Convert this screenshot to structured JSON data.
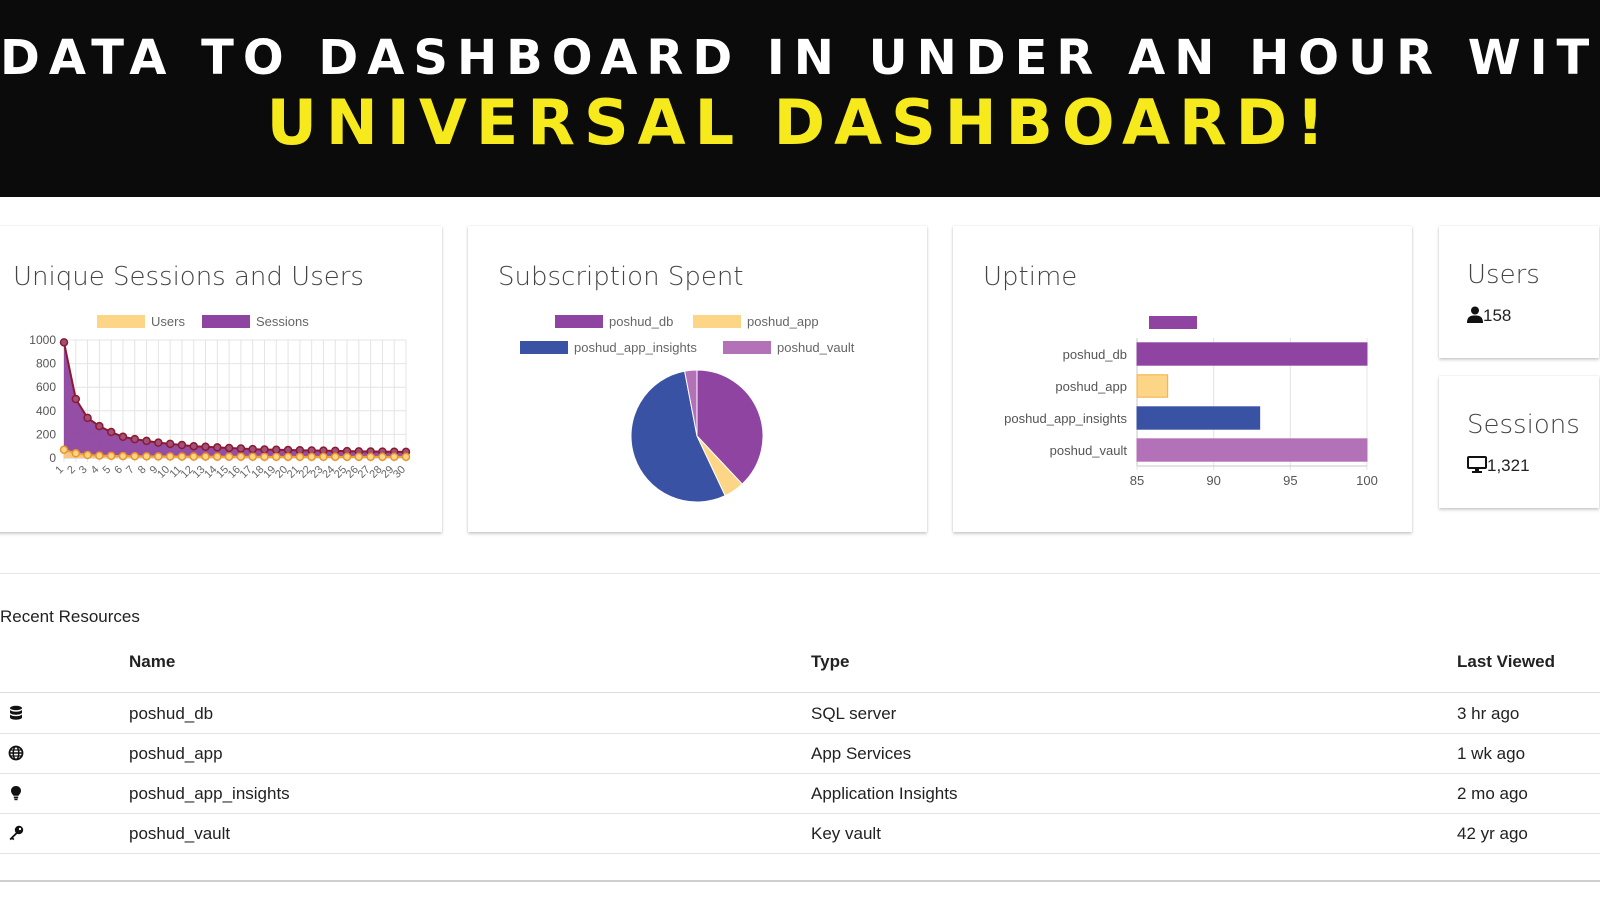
{
  "banner": {
    "line1": "Data to dashboard in under an hour with",
    "line2": "Universal Dashboard!"
  },
  "colors": {
    "banner_bg": "#0b0b0b",
    "banner_yellow": "#f7ea1c",
    "purple": "#8e44a0",
    "dark_red": "#8b1a2e",
    "yellow": "#fdd587",
    "blue": "#3a52a3",
    "lavender": "#b371b8"
  },
  "sessions_card": {
    "title": "Unique Sessions and Users",
    "legend": [
      "Users",
      "Sessions"
    ]
  },
  "subscription_card": {
    "title": "Subscription Spent",
    "legend": [
      "poshud_db",
      "poshud_app",
      "poshud_app_insights",
      "poshud_vault"
    ]
  },
  "uptime_card": {
    "title": "Uptime"
  },
  "users_card": {
    "title": "Users",
    "icon": "user-icon",
    "value": "158"
  },
  "sessions_stat_card": {
    "title": "Sessions",
    "icon": "monitor-icon",
    "value": "1,321"
  },
  "recent": {
    "title": "Recent Resources",
    "headers": [
      "Name",
      "Type",
      "Last Viewed"
    ],
    "rows": [
      {
        "icon": "database-icon",
        "name": "poshud_db",
        "type": "SQL server",
        "last": "3 hr ago"
      },
      {
        "icon": "globe-icon",
        "name": "poshud_app",
        "type": "App Services",
        "last": "1 wk ago"
      },
      {
        "icon": "lightbulb-icon",
        "name": "poshud_app_insights",
        "type": "Application Insights",
        "last": "2 mo ago"
      },
      {
        "icon": "key-icon",
        "name": "poshud_vault",
        "type": "Key vault",
        "last": "42 yr ago"
      }
    ]
  },
  "chart_data": [
    {
      "type": "area",
      "title": "Unique Sessions and Users",
      "x": [
        1,
        2,
        3,
        4,
        5,
        6,
        7,
        8,
        9,
        10,
        11,
        12,
        13,
        14,
        15,
        16,
        17,
        18,
        19,
        20,
        21,
        22,
        23,
        24,
        25,
        26,
        27,
        28,
        29,
        30
      ],
      "yticks": [
        "0",
        "200",
        "400",
        "600",
        "800",
        "1000"
      ],
      "ylim": [
        0,
        1000
      ],
      "grid": true,
      "legend_position": "top",
      "series": [
        {
          "name": "Users",
          "color": "#fdd587",
          "values": [
            70,
            40,
            25,
            20,
            18,
            16,
            15,
            14,
            13,
            13,
            12,
            12,
            12,
            11,
            11,
            11,
            11,
            10,
            10,
            10,
            10,
            10,
            10,
            10,
            10,
            10,
            10,
            10,
            10,
            10
          ]
        },
        {
          "name": "Sessions",
          "color": "#8e44a0",
          "values": [
            980,
            500,
            340,
            270,
            220,
            180,
            160,
            145,
            130,
            120,
            110,
            100,
            95,
            90,
            85,
            80,
            75,
            72,
            70,
            68,
            66,
            64,
            62,
            60,
            58,
            56,
            55,
            54,
            53,
            52
          ]
        }
      ]
    },
    {
      "type": "pie",
      "title": "Subscription Spent",
      "legend_position": "top",
      "categories": [
        "poshud_db",
        "poshud_app",
        "poshud_app_insights",
        "poshud_vault"
      ],
      "values": [
        38,
        5,
        54,
        3
      ],
      "colors": [
        "#8e44a0",
        "#fdd587",
        "#3a52a3",
        "#b371b8"
      ]
    },
    {
      "type": "bar",
      "orientation": "horizontal",
      "title": "Uptime",
      "categories": [
        "poshud_db",
        "poshud_app",
        "poshud_app_insights",
        "poshud_vault"
      ],
      "values": [
        100,
        87,
        93,
        100
      ],
      "colors": [
        "#8e44a0",
        "#fdd587",
        "#3a52a3",
        "#b371b8"
      ],
      "xticks": [
        "85",
        "90",
        "95",
        "100"
      ],
      "xlim": [
        85,
        100
      ],
      "grid": true,
      "legend_position": "top"
    }
  ]
}
